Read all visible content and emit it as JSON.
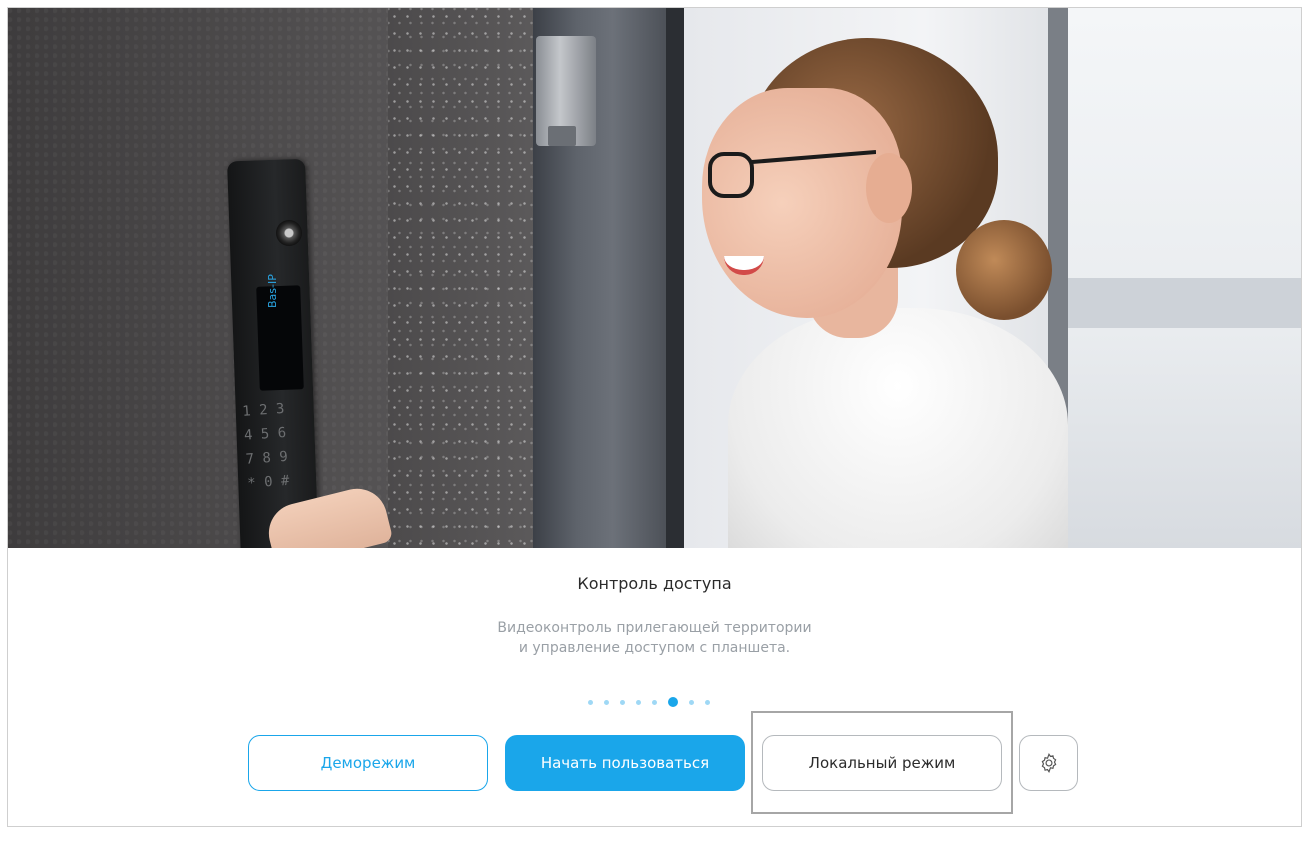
{
  "slide": {
    "title": "Контроль доступа",
    "description_line1": "Видеоконтроль прилегающей территории",
    "description_line2": "и управление доступом с планшета.",
    "intercom_screen_text": "Bas-IP",
    "intercom_keys": "1 2 3\n4 5 6\n7 8 9\n* 0 #"
  },
  "pagination": {
    "total": 8,
    "active_index": 5
  },
  "buttons": {
    "demo_label": "Деморежим",
    "start_label": "Начать пользоваться",
    "local_label": "Локальный режим",
    "settings_icon": "gear-icon"
  },
  "colors": {
    "accent": "#1aa6ea",
    "accent_light": "#9fd8f5",
    "border": "#b5b9bd",
    "text": "#2b2b2b",
    "muted_text": "#9aa0a6"
  }
}
